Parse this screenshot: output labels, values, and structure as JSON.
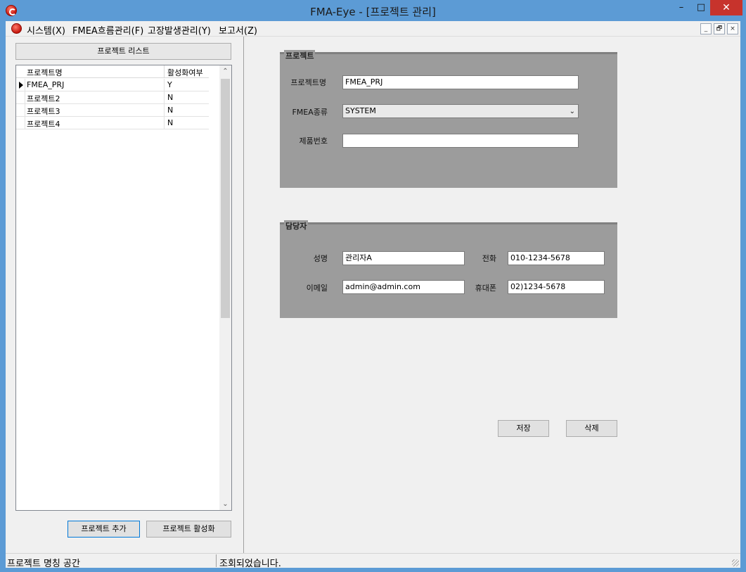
{
  "window": {
    "title": "FMA-Eye - [프로젝트 관리]",
    "min_glyph": "–",
    "max_glyph": "□",
    "close_glyph": "✕"
  },
  "menu": {
    "items": [
      "시스템(X)",
      "FMEA흐름관리(F)",
      "고장발생관리(Y)",
      "보고서(Z)"
    ],
    "mdi_min": "_",
    "mdi_restore": "🗗",
    "mdi_close": "×"
  },
  "left": {
    "list_title": "프로젝트 리스트",
    "columns": [
      "프로젝트명",
      "활성화여부"
    ],
    "rows": [
      {
        "name": "FMEA_PRJ",
        "active": "Y"
      },
      {
        "name": "프로젝트2",
        "active": "N"
      },
      {
        "name": "프로젝트3",
        "active": "N"
      },
      {
        "name": "프로젝트4",
        "active": "N"
      }
    ],
    "add_button": "프로젝트 추가",
    "activate_button": "프로젝트 활성화"
  },
  "project": {
    "group_title": "프로젝트",
    "name_label": "프로젝트명",
    "name_value": "FMEA_PRJ",
    "type_label": "FMEA종류",
    "type_value": "SYSTEM",
    "product_label": "제품번호",
    "product_value": ""
  },
  "manager": {
    "group_title": "담당자",
    "name_label": "성명",
    "name_value": "관리자A",
    "phone_label": "전화",
    "phone_value": "010-1234-5678",
    "email_label": "이메일",
    "email_value": "admin@admin.com",
    "mobile_label": "휴대폰",
    "mobile_value": "02)1234-5678"
  },
  "actions": {
    "save": "저장",
    "delete": "삭제"
  },
  "status": {
    "left": "프로젝트 명칭 공간",
    "right": "조회되었습니다."
  }
}
